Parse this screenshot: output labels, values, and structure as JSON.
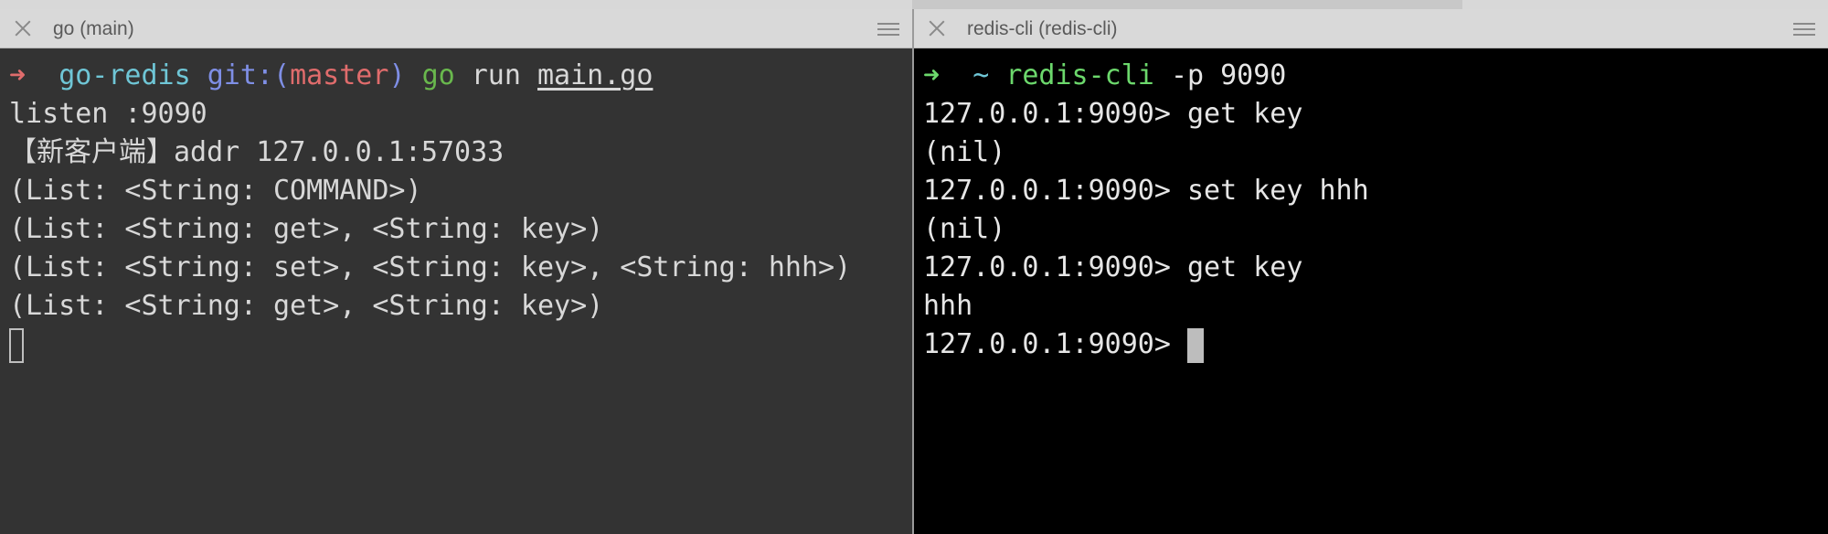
{
  "window": {
    "left_pane": {
      "tab_title": "go (main)",
      "prompt": {
        "arrow": "➜",
        "dir": "go-redis",
        "git_label": "git:(",
        "branch": "master",
        "git_close": ")",
        "cmd": "go",
        "args": "run",
        "file": "main.go"
      },
      "output": [
        "listen :9090",
        "【新客户端】addr 127.0.0.1:57033",
        "(List: <String: COMMAND>)",
        "(List: <String: get>, <String: key>)",
        "(List: <String: set>, <String: key>, <String: hhh>)",
        "(List: <String: get>, <String: key>)"
      ]
    },
    "right_pane": {
      "tab_title": "redis-cli (redis-cli)",
      "prompt": {
        "arrow": "➜",
        "dir": "~",
        "cmd": "redis-cli",
        "args": "-p 9090"
      },
      "session": [
        "127.0.0.1:9090> get key",
        "(nil)",
        "127.0.0.1:9090> set key hhh",
        "(nil)",
        "127.0.0.1:9090> get key",
        "hhh"
      ],
      "current_prompt": "127.0.0.1:9090> "
    }
  },
  "colors": {
    "left_bg": "#333333",
    "right_bg": "#000000",
    "prompt_red": "#e06c6c",
    "prompt_green": "#6cd86c",
    "dir_cyan": "#6fc6d6",
    "git_blue": "#7f8fe6"
  },
  "icons": {
    "close": "close-icon",
    "menu": "hamburger-menu-icon"
  }
}
